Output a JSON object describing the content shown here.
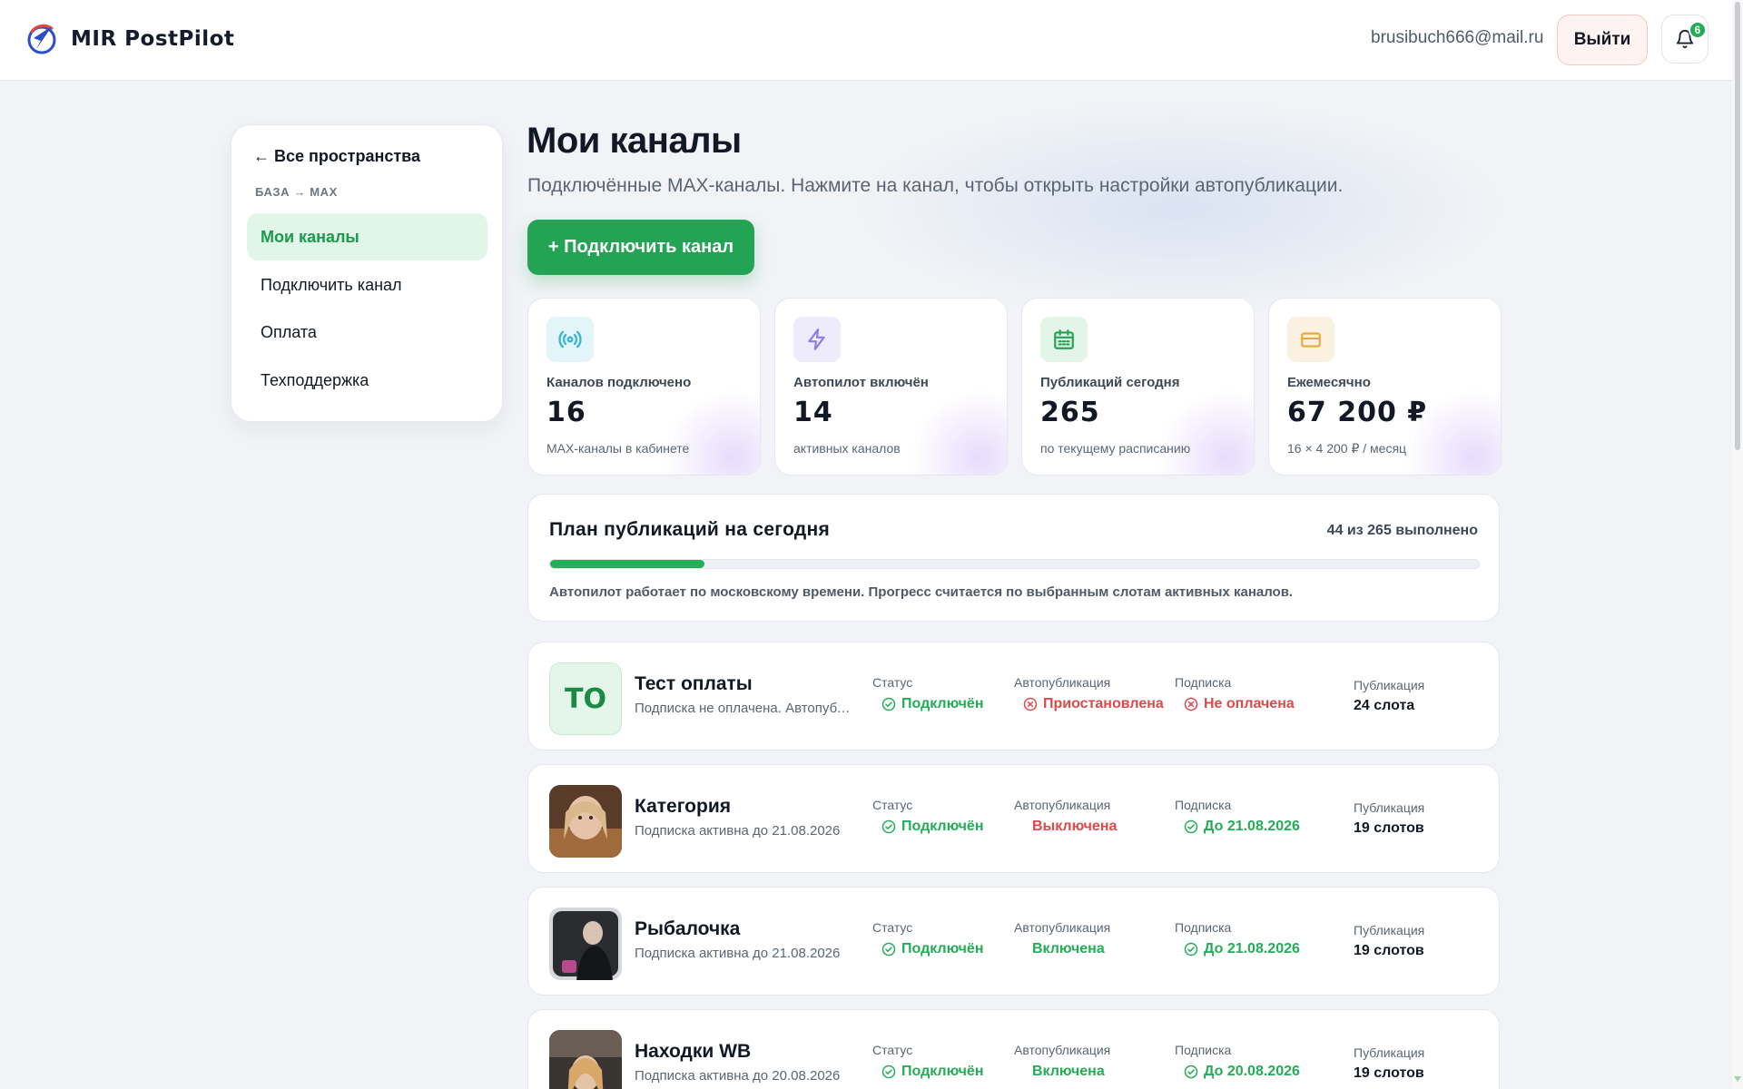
{
  "header": {
    "logo_text": "MIR PostPilot",
    "user_email": "brusibuch666@mail.ru",
    "logout_label": "Выйти",
    "notifications_count": "6"
  },
  "sidebar": {
    "back_label": "← Все пространства",
    "breadcrumb": "БАЗА → MAX",
    "items": [
      {
        "label": "Мои каналы",
        "active": true
      },
      {
        "label": "Подключить канал"
      },
      {
        "label": "Оплата"
      },
      {
        "label": "Техподдержка"
      }
    ]
  },
  "main": {
    "title": "Мои каналы",
    "subtitle": "Подключённые MAX-каналы. Нажмите на канал, чтобы открыть настройки автопубликации.",
    "connect_button": "+ Подключить канал"
  },
  "stats": [
    {
      "icon": "broadcast-icon",
      "label": "Каналов подключено",
      "value": "16",
      "sub": "MAX-каналы в кабинете",
      "accent": "#38b6d6"
    },
    {
      "icon": "lightning-icon",
      "label": "Автопилот включён",
      "value": "14",
      "sub": "активных каналов",
      "accent": "#8b7cf0"
    },
    {
      "icon": "calendar-icon",
      "label": "Публикаций сегодня",
      "value": "265",
      "sub": "по текущему расписанию",
      "accent": "#23a455"
    },
    {
      "icon": "card-icon",
      "label": "Ежемесячно",
      "value": "67 200 ₽",
      "sub": "16 × 4 200 ₽ / месяц",
      "accent": "#e7a93a"
    }
  ],
  "plan": {
    "title": "План публикаций на сегодня",
    "count": "44 из 265 выполнено",
    "progress_fraction": 0.166,
    "note": "Автопилот работает по московскому времени. Прогресс считается по выбранным слотам активных каналов."
  },
  "columns": {
    "status": "Статус",
    "autopub": "Автопубликация",
    "subscription": "Подписка",
    "publication": "Публикация"
  },
  "channels": [
    {
      "initials": "ТО",
      "name": "Тест оплаты",
      "desc": "Подписка не оплачена. Автопубликация приостановлена",
      "status": "Подключён",
      "autopub": "Приостановлена",
      "autopub_state": "bad-icon",
      "subscription": "Не оплачена",
      "sub_state": "bad-icon",
      "slots": "24 слота"
    },
    {
      "initials": "",
      "name": "Категория",
      "desc": "Подписка активна до 21.08.2026",
      "status": "Подключён",
      "autopub": "Выключена",
      "autopub_state": "bad",
      "subscription": "До 21.08.2026",
      "sub_state": "ok-icon",
      "slots": "19 слотов"
    },
    {
      "initials": "",
      "name": "Рыбалочка",
      "desc": "Подписка активна до 21.08.2026",
      "status": "Подключён",
      "autopub": "Включена",
      "autopub_state": "ok",
      "subscription": "До 21.08.2026",
      "sub_state": "ok-icon",
      "slots": "19 слотов"
    },
    {
      "initials": "",
      "name": "Находки WB",
      "desc": "Подписка активна до 20.08.2026",
      "status": "Подключён",
      "autopub": "Включена",
      "autopub_state": "ok",
      "subscription": "До 20.08.2026",
      "sub_state": "ok-icon",
      "slots": "19 слотов"
    }
  ]
}
